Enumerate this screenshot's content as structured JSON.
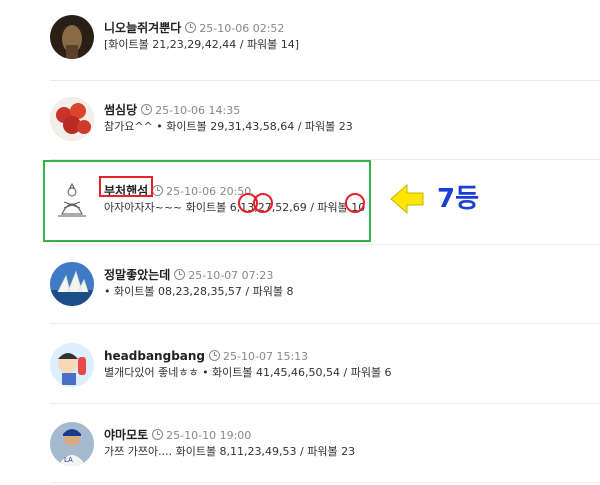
{
  "comments": [
    {
      "name": "니오늘쥐겨뿐다",
      "date": "25-10-06 02:52",
      "text": "[화이트볼 21,23,29,42,44 / 파워볼 14]"
    },
    {
      "name": "썸심당",
      "date": "25-10-06 14:35",
      "text": "참가요^^ • 화이트볼 29,31,43,58,64 / 파워볼 23"
    },
    {
      "name": "부처핸섬",
      "date": "25-10-06 20:50",
      "text": "아자아자자~~~ 화이트볼 6,13,27,52,69 / 파워볼 10"
    },
    {
      "name": "정말좋았는데",
      "date": "25-10-07 07:23",
      "text": "• 화이트볼 08,23,28,35,57 / 파워볼 8"
    },
    {
      "name": "headbangbang",
      "date": "25-10-07 15:13",
      "text": "별개다있어 좋네ㅎㅎ • 화이트볼 41,45,46,50,54 / 파워볼 6"
    },
    {
      "name": "야마모토",
      "date": "25-10-10 19:00",
      "text": "가쯔 가쯔아.... 화이트볼 8,11,23,49,53 / 파워볼 23"
    }
  ],
  "annotation": {
    "rank_label": "7등"
  },
  "colors": {
    "highlight_box": "#33b24a",
    "marker": "#e5222a",
    "rank": "#1a3fd6",
    "arrow": "#ffe600"
  }
}
